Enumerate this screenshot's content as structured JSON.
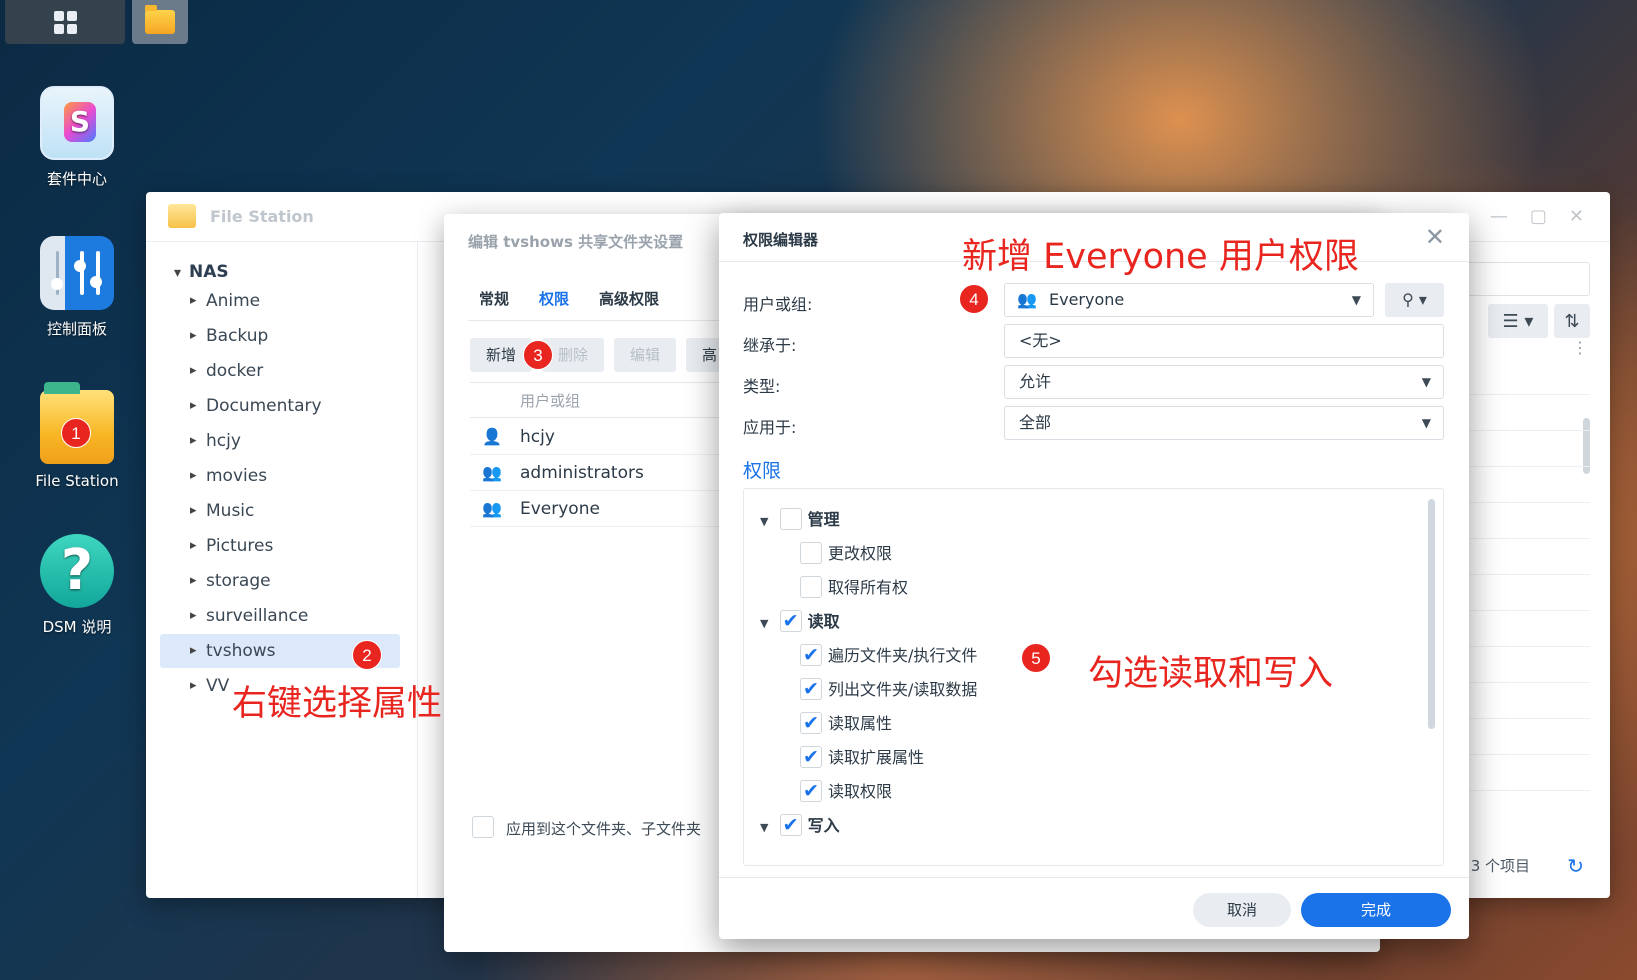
{
  "desktop": {
    "icons": [
      {
        "label": "套件中心"
      },
      {
        "label": "控制面板"
      },
      {
        "label": "File Station"
      },
      {
        "label": "DSM 说明"
      }
    ],
    "help_glyph": "?",
    "pkg_glyph": "S"
  },
  "file_station": {
    "title": "File Station",
    "root": "NAS",
    "folders": [
      "Anime",
      "Backup",
      "docker",
      "Documentary",
      "hcjy",
      "movies",
      "Music",
      "Pictures",
      "storage",
      "surveillance",
      "tvshows",
      "VV"
    ],
    "selected_folder": "tvshows",
    "item_count": "3 个项目"
  },
  "share_dialog": {
    "title": "编辑 tvshows 共享文件夹设置",
    "tabs": [
      "常规",
      "权限",
      "高级权限"
    ],
    "active_tab": "权限",
    "toolbar": {
      "add": "新增",
      "delete": "删除",
      "edit": "编辑",
      "more": "高"
    },
    "column_header": "用户或组",
    "rows": [
      {
        "name": "hcjy",
        "icon": "user-icon"
      },
      {
        "name": "administrators",
        "icon": "group-icon"
      },
      {
        "name": "Everyone",
        "icon": "group-icon"
      }
    ],
    "apply_text": "应用到这个文件夹、子文件夹"
  },
  "perm_editor": {
    "title": "权限编辑器",
    "fields": {
      "user_label": "用户或组:",
      "user_value": "Everyone",
      "inherit_label": "继承于:",
      "inherit_value": "<无>",
      "type_label": "类型:",
      "type_value": "允许",
      "apply_label": "应用于:",
      "apply_value": "全部"
    },
    "section": "权限",
    "tree": {
      "manage": {
        "label": "管理",
        "checked": false
      },
      "change_perm": {
        "label": "更改权限",
        "checked": false
      },
      "take_owner": {
        "label": "取得所有权",
        "checked": false
      },
      "read": {
        "label": "读取",
        "checked": true
      },
      "traverse": {
        "label": "遍历文件夹/执行文件",
        "checked": true
      },
      "list": {
        "label": "列出文件夹/读取数据",
        "checked": true
      },
      "read_attr": {
        "label": "读取属性",
        "checked": true
      },
      "read_ext_attr": {
        "label": "读取扩展属性",
        "checked": true
      },
      "read_perm": {
        "label": "读取权限",
        "checked": true
      },
      "write": {
        "label": "写入",
        "checked": true
      }
    },
    "cancel": "取消",
    "done": "完成"
  },
  "annotations": {
    "badges": [
      "1",
      "2",
      "3",
      "4",
      "5"
    ],
    "note_right_click": "右键选择属性",
    "note_add_everyone": "新增 Everyone 用户权限",
    "note_check": "勾选读取和写入",
    "color": "#e8261f"
  },
  "colors": {
    "accent": "#1a73e8",
    "selected_row": "#dbe9fb"
  }
}
